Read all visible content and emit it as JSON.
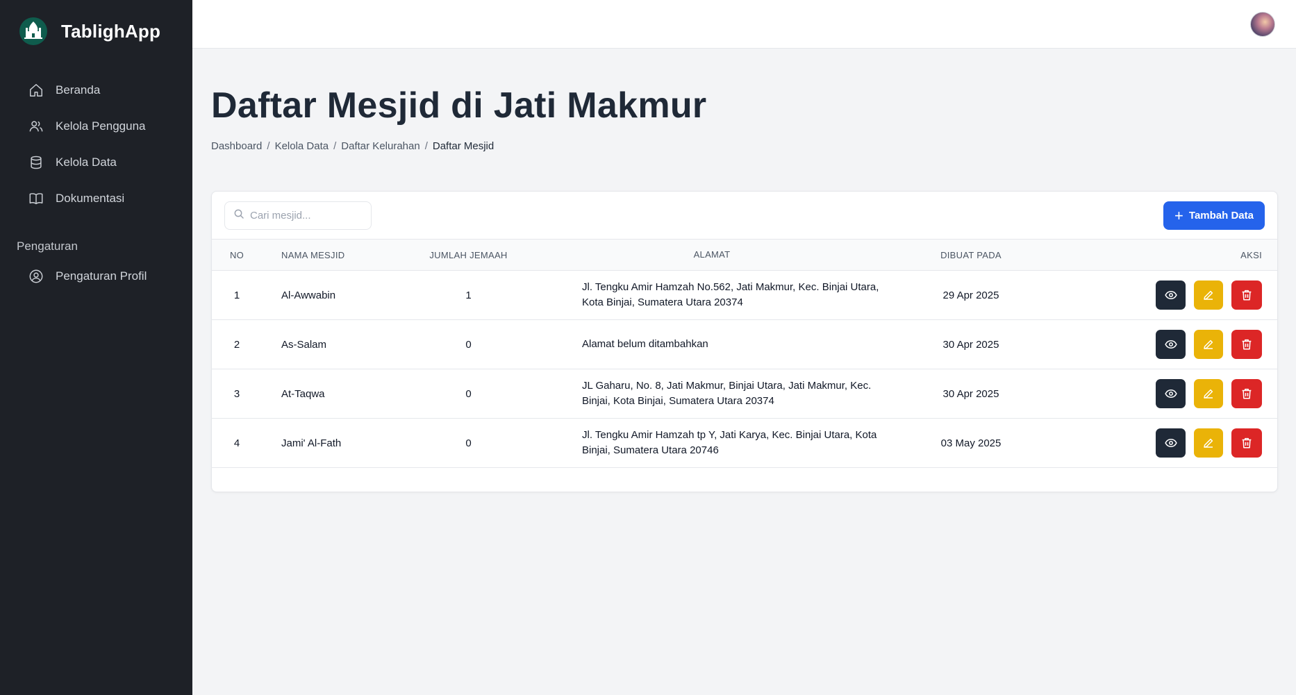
{
  "app": {
    "name": "TablighApp"
  },
  "sidebar": {
    "items": [
      {
        "label": "Beranda",
        "icon": "home-icon"
      },
      {
        "label": "Kelola Pengguna",
        "icon": "users-icon"
      },
      {
        "label": "Kelola Data",
        "icon": "database-icon"
      },
      {
        "label": "Dokumentasi",
        "icon": "book-icon"
      }
    ],
    "section_label": "Pengaturan",
    "settings_items": [
      {
        "label": "Pengaturan Profil",
        "icon": "user-circle-icon"
      }
    ]
  },
  "page": {
    "title": "Daftar Mesjid di Jati Makmur",
    "breadcrumb": [
      "Dashboard",
      "Kelola Data",
      "Daftar Kelurahan",
      "Daftar Mesjid"
    ]
  },
  "toolbar": {
    "search_placeholder": "Cari mesjid...",
    "add_label": "Tambah Data"
  },
  "table": {
    "headers": [
      "NO",
      "NAMA MESJID",
      "JUMLAH JEMAAH",
      "ALAMAT",
      "DIBUAT PADA",
      "AKSI"
    ],
    "rows": [
      {
        "no": "1",
        "nama": "Al-Awwabin",
        "jemaah": "1",
        "alamat": "Jl. Tengku Amir Hamzah No.562, Jati Makmur, Kec. Binjai Utara, Kota Binjai, Sumatera Utara 20374",
        "dibuat": "29 Apr 2025"
      },
      {
        "no": "2",
        "nama": "As-Salam",
        "jemaah": "0",
        "alamat": "Alamat belum ditambahkan",
        "dibuat": "30 Apr 2025"
      },
      {
        "no": "3",
        "nama": "At-Taqwa",
        "jemaah": "0",
        "alamat": "JL Gaharu, No. 8, Jati Makmur, Binjai Utara, Jati Makmur, Kec. Binjai, Kota Binjai, Sumatera Utara 20374",
        "dibuat": "30 Apr 2025"
      },
      {
        "no": "4",
        "nama": "Jami' Al-Fath",
        "jemaah": "0",
        "alamat": "Jl. Tengku Amir Hamzah tp Y, Jati Karya, Kec. Binjai Utara, Kota Binjai, Sumatera Utara 20746",
        "dibuat": "03 May 2025"
      }
    ]
  },
  "colors": {
    "sidebar_bg": "#1e2127",
    "primary": "#2563eb",
    "view_btn": "#1f2937",
    "edit_btn": "#eab308",
    "delete_btn": "#dc2626"
  }
}
